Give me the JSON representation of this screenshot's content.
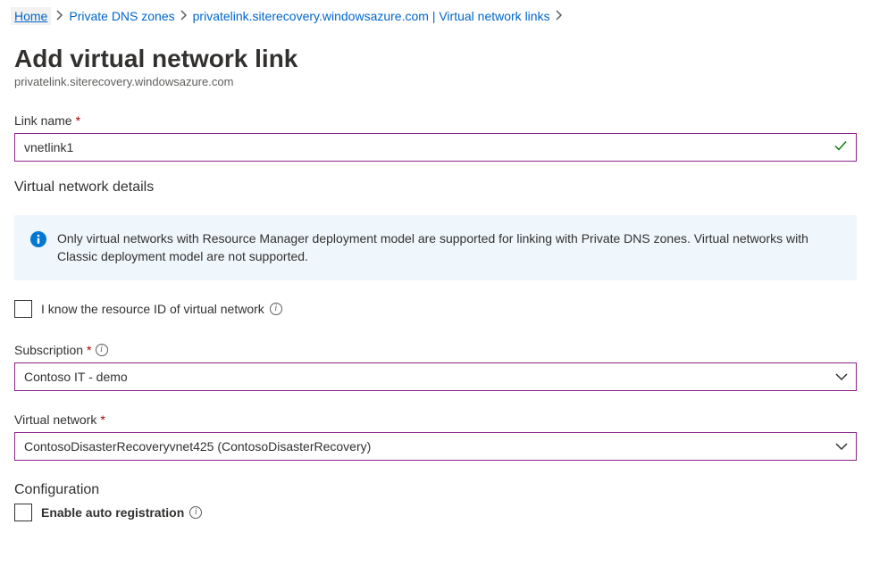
{
  "breadcrumb": {
    "home": "Home",
    "dns_zones": "Private DNS zones",
    "zone_detail": "privatelink.siterecovery.windowsazure.com | Virtual network links"
  },
  "page": {
    "title": "Add virtual network link",
    "subtitle": "privatelink.siterecovery.windowsazure.com"
  },
  "form": {
    "link_name_label": "Link name",
    "link_name_value": "vnetlink1",
    "vnet_details_heading": "Virtual network details",
    "info_text": "Only virtual networks with Resource Manager deployment model are supported for linking with Private DNS zones. Virtual networks with Classic deployment model are not supported.",
    "know_resource_id_label": "I know the resource ID of virtual network",
    "subscription_label": "Subscription",
    "subscription_value": "Contoso IT - demo",
    "virtual_network_label": "Virtual network",
    "virtual_network_value": "ContosoDisasterRecoveryvnet425 (ContosoDisasterRecovery)",
    "configuration_heading": "Configuration",
    "enable_auto_reg_label": "Enable auto registration"
  }
}
